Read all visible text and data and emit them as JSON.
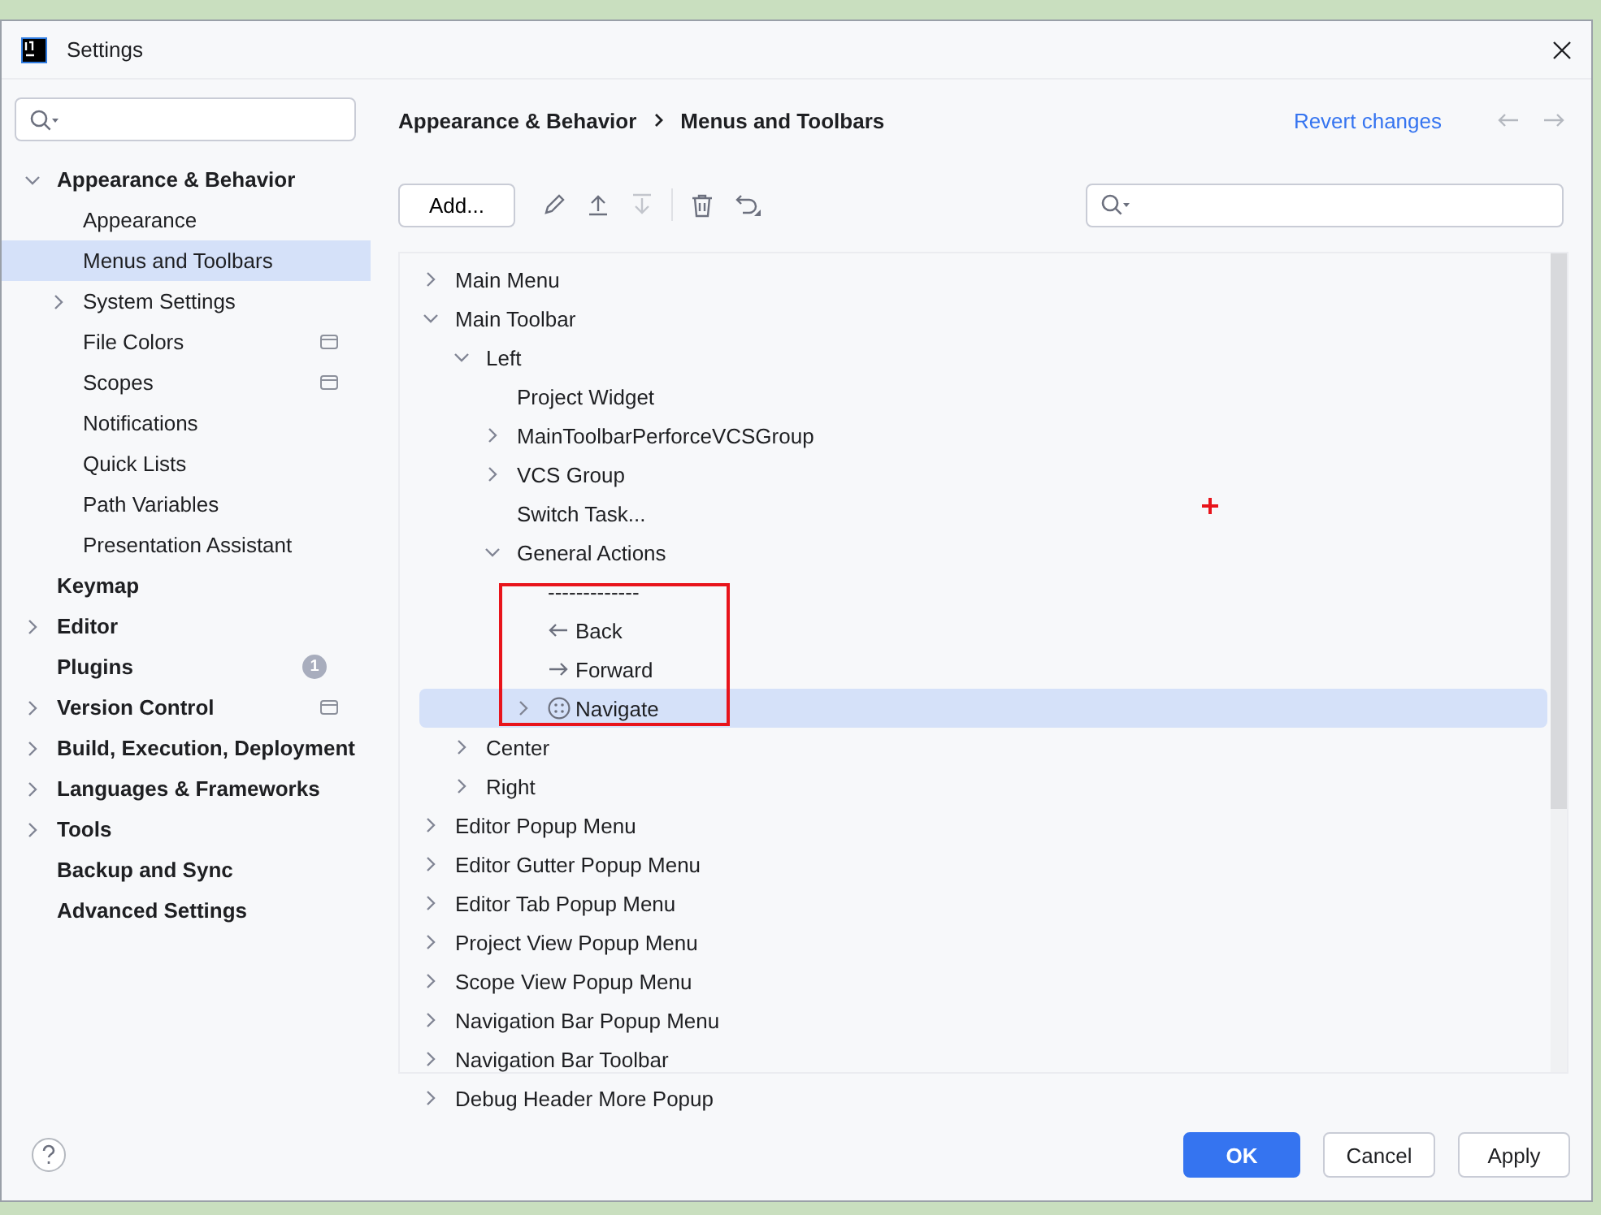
{
  "window": {
    "title": "Settings"
  },
  "sidebar": {
    "items": [
      {
        "label": "Appearance & Behavior",
        "expanded": true,
        "selected": false,
        "children": [
          {
            "label": "Appearance",
            "selected": false
          },
          {
            "label": "Menus and Toolbars",
            "selected": true
          },
          {
            "label": "System Settings",
            "expanded": false,
            "selected": false
          },
          {
            "label": "File Colors",
            "selected": false,
            "scope_icon": true
          },
          {
            "label": "Scopes",
            "selected": false,
            "scope_icon": true
          },
          {
            "label": "Notifications",
            "selected": false
          },
          {
            "label": "Quick Lists",
            "selected": false
          },
          {
            "label": "Path Variables",
            "selected": false
          },
          {
            "label": "Presentation Assistant",
            "selected": false
          }
        ]
      },
      {
        "label": "Keymap",
        "selected": false
      },
      {
        "label": "Editor",
        "expanded": false,
        "selected": false
      },
      {
        "label": "Plugins",
        "selected": false,
        "badge": "1"
      },
      {
        "label": "Version Control",
        "expanded": false,
        "selected": false,
        "scope_icon": true
      },
      {
        "label": "Build, Execution, Deployment",
        "expanded": false,
        "selected": false
      },
      {
        "label": "Languages & Frameworks",
        "expanded": false,
        "selected": false
      },
      {
        "label": "Tools",
        "expanded": false,
        "selected": false
      },
      {
        "label": "Backup and Sync",
        "selected": false
      },
      {
        "label": "Advanced Settings",
        "selected": false
      }
    ]
  },
  "breadcrumb": [
    "Appearance & Behavior",
    "Menus and Toolbars"
  ],
  "revert_link": "Revert changes",
  "toolbar": {
    "add_button": "Add..."
  },
  "tree": [
    {
      "label": "Main Menu",
      "kind": "plain",
      "expanded": false,
      "selected": false
    },
    {
      "label": "Main Toolbar",
      "kind": "plain",
      "expanded": true,
      "selected": false,
      "children": [
        {
          "label": "Left",
          "kind": "plain",
          "expanded": true,
          "selected": false,
          "children": [
            {
              "label": "Project Widget",
              "kind": "plain",
              "selected": false
            },
            {
              "label": "MainToolbarPerforceVCSGroup",
              "kind": "plain",
              "expanded": false,
              "selected": false
            },
            {
              "label": "VCS Group",
              "kind": "plain",
              "expanded": false,
              "selected": false
            },
            {
              "label": "Switch Task...",
              "kind": "plain",
              "selected": false
            },
            {
              "label": "General Actions",
              "kind": "plain",
              "expanded": true,
              "selected": false,
              "children": [
                {
                  "label": "-------------",
                  "kind": "separator",
                  "selected": false
                },
                {
                  "label": "Back",
                  "kind": "back",
                  "selected": false
                },
                {
                  "label": "Forward",
                  "kind": "forward",
                  "selected": false
                },
                {
                  "label": "Navigate",
                  "kind": "navigate",
                  "expanded": false,
                  "selected": true
                }
              ]
            }
          ]
        },
        {
          "label": "Center",
          "kind": "plain",
          "expanded": false,
          "selected": false
        },
        {
          "label": "Right",
          "kind": "plain",
          "expanded": false,
          "selected": false
        }
      ]
    },
    {
      "label": "Editor Popup Menu",
      "kind": "plain",
      "expanded": false,
      "selected": false
    },
    {
      "label": "Editor Gutter Popup Menu",
      "kind": "plain",
      "expanded": false,
      "selected": false
    },
    {
      "label": "Editor Tab Popup Menu",
      "kind": "plain",
      "expanded": false,
      "selected": false
    },
    {
      "label": "Project View Popup Menu",
      "kind": "plain",
      "expanded": false,
      "selected": false
    },
    {
      "label": "Scope View Popup Menu",
      "kind": "plain",
      "expanded": false,
      "selected": false
    },
    {
      "label": "Navigation Bar Popup Menu",
      "kind": "plain",
      "expanded": false,
      "selected": false
    },
    {
      "label": "Navigation Bar Toolbar",
      "kind": "plain",
      "expanded": false,
      "selected": false
    },
    {
      "label": "Debug Header More Popup",
      "kind": "plain",
      "expanded": false,
      "selected": false
    }
  ],
  "buttons": [
    {
      "label": "OK",
      "kind": "primary"
    },
    {
      "label": "Cancel",
      "kind": "secondary"
    },
    {
      "label": "Apply",
      "kind": "secondary"
    }
  ]
}
